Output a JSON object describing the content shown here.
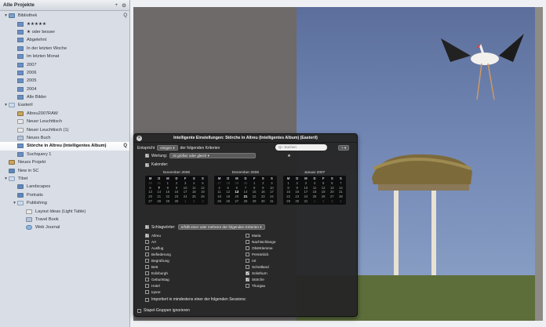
{
  "sidebar": {
    "title": "Alle Projekte",
    "header_add": "+",
    "header_gear": "⚙",
    "tree": [
      {
        "label": "Bibliothek",
        "level": 0,
        "expanded": true,
        "icon": "library",
        "action": "Q"
      },
      {
        "label": "★★★★★",
        "level": 1,
        "icon": "smart"
      },
      {
        "label": "★ oder besser",
        "level": 1,
        "icon": "smart"
      },
      {
        "label": "Abgelehnt",
        "level": 1,
        "icon": "smart"
      },
      {
        "label": "In der letzten Woche",
        "level": 1,
        "icon": "smart"
      },
      {
        "label": "Im letzten Monat",
        "level": 1,
        "icon": "smart"
      },
      {
        "label": "2007",
        "level": 1,
        "icon": "smart"
      },
      {
        "label": "2006",
        "level": 1,
        "icon": "smart"
      },
      {
        "label": "2005",
        "level": 1,
        "icon": "smart"
      },
      {
        "label": "2004",
        "level": 1,
        "icon": "smart"
      },
      {
        "label": "Alle Bilder",
        "level": 1,
        "icon": "smart"
      },
      {
        "label": "Easteril",
        "level": 0,
        "expanded": true,
        "icon": "folder"
      },
      {
        "label": "Altreu2007RAW",
        "level": 1,
        "icon": "project"
      },
      {
        "label": "Neuer Leuchttisch",
        "level": 1,
        "icon": "layout"
      },
      {
        "label": "Neuer Leuchttisch (1)",
        "level": 1,
        "icon": "layout"
      },
      {
        "label": "Neues Buch",
        "level": 1,
        "icon": "book"
      },
      {
        "label": "Störche in Altreu (Intelligentes Album)",
        "level": 1,
        "icon": "smart",
        "selected": true,
        "action": "Q"
      },
      {
        "label": "Suchquery 1",
        "level": 1,
        "icon": "smart"
      },
      {
        "label": "Neues Projekt",
        "level": 0,
        "icon": "project"
      },
      {
        "label": "New in SC",
        "level": 0,
        "icon": "album"
      },
      {
        "label": "Tibet",
        "level": 0,
        "expanded": true,
        "icon": "folder"
      },
      {
        "label": "Landscapes",
        "level": 1,
        "icon": "album"
      },
      {
        "label": "Portraits",
        "level": 1,
        "icon": "album"
      },
      {
        "label": "Publishing",
        "level": 1,
        "expanded": true,
        "icon": "folder"
      },
      {
        "label": "Layout Ideas (Light Table)",
        "level": 2,
        "icon": "layout"
      },
      {
        "label": "Travel Book",
        "level": 2,
        "icon": "book"
      },
      {
        "label": "Web Journal",
        "level": 2,
        "icon": "web"
      }
    ]
  },
  "hud": {
    "title": "Intelligente Einstellungen: Störche in Altreu (Intelligentes Album) (Easteril)",
    "close": "×",
    "match_prefix": "Entspricht",
    "match_value": "einigen",
    "match_suffix": "der folgenden Kriterien",
    "search_placeholder": "Q– Suchen",
    "add_button": "+",
    "rating_label": "Wertung:",
    "rating_op": "ist größer oder gleich",
    "rating_value": "★",
    "calendar_label": "Kalender:",
    "calendars": [
      {
        "title": "November 2006",
        "headers": [
          "M",
          "D",
          "M",
          "D",
          "F",
          "S",
          "S"
        ],
        "days": [
          "30",
          "31",
          "1",
          "2",
          "3",
          "4",
          "5",
          "6",
          "7",
          "8",
          "9",
          "10",
          "11",
          "12",
          "13",
          "14",
          "15",
          "16",
          "17",
          "18",
          "19",
          "20",
          "21",
          "22",
          "23",
          "24",
          "25",
          "26",
          "27",
          "28",
          "29",
          "30",
          "1",
          "2",
          "3"
        ],
        "muted": [
          0,
          1,
          32,
          33,
          34
        ],
        "bold": [
          8
        ]
      },
      {
        "title": "Dezember 2006",
        "headers": [
          "M",
          "D",
          "M",
          "D",
          "F",
          "S",
          "S"
        ],
        "days": [
          "27",
          "28",
          "29",
          "30",
          "1",
          "2",
          "3",
          "4",
          "5",
          "6",
          "7",
          "8",
          "9",
          "10",
          "11",
          "12",
          "13",
          "14",
          "15",
          "16",
          "17",
          "18",
          "19",
          "20",
          "21",
          "22",
          "23",
          "24",
          "25",
          "26",
          "27",
          "28",
          "29",
          "30",
          "31"
        ],
        "muted": [
          0,
          1,
          2,
          3
        ],
        "bold": [
          16,
          24
        ]
      },
      {
        "title": "Januar 2007",
        "headers": [
          "M",
          "D",
          "M",
          "D",
          "F",
          "S",
          "S"
        ],
        "days": [
          "1",
          "2",
          "3",
          "4",
          "5",
          "6",
          "7",
          "8",
          "9",
          "10",
          "11",
          "12",
          "13",
          "14",
          "15",
          "16",
          "17",
          "18",
          "19",
          "20",
          "21",
          "22",
          "23",
          "24",
          "25",
          "26",
          "27",
          "28",
          "29",
          "30",
          "31",
          "1",
          "2",
          "3",
          "4"
        ],
        "muted": [
          31,
          32,
          33,
          34
        ],
        "bold": []
      }
    ],
    "keywords_label": "Schlagwörter:",
    "keywords_op": "erfüllt einer oder mehrere der folgenden Kriterien",
    "keywords_left": [
      {
        "label": "Altreu",
        "checked": true
      },
      {
        "label": "Art",
        "checked": false
      },
      {
        "label": "Ausflug",
        "checked": false
      },
      {
        "label": "Befiederung",
        "checked": false
      },
      {
        "label": "Begrüßung",
        "checked": false
      },
      {
        "label": "Bett",
        "checked": false
      },
      {
        "label": "Edinburgh",
        "checked": false
      },
      {
        "label": "Geburtstag",
        "checked": false
      },
      {
        "label": "Hotel",
        "checked": false
      },
      {
        "label": "Iqone",
        "checked": false
      }
    ],
    "keywords_right": [
      {
        "label": "Maria",
        "checked": false
      },
      {
        "label": "Nachtschlange",
        "checked": false
      },
      {
        "label": "ObstKlemme",
        "checked": false
      },
      {
        "label": "Persönlich",
        "checked": false
      },
      {
        "label": "rot",
        "checked": false
      },
      {
        "label": "Schottland",
        "checked": false
      },
      {
        "label": "Solothurn",
        "checked": true
      },
      {
        "label": "Störche",
        "checked": true
      },
      {
        "label": "Thurgau",
        "checked": false
      }
    ],
    "important_label": "Importiert in mindestens einer der folgenden Sessions:",
    "stack_label": "Stapel-Gruppen ignorieren"
  }
}
